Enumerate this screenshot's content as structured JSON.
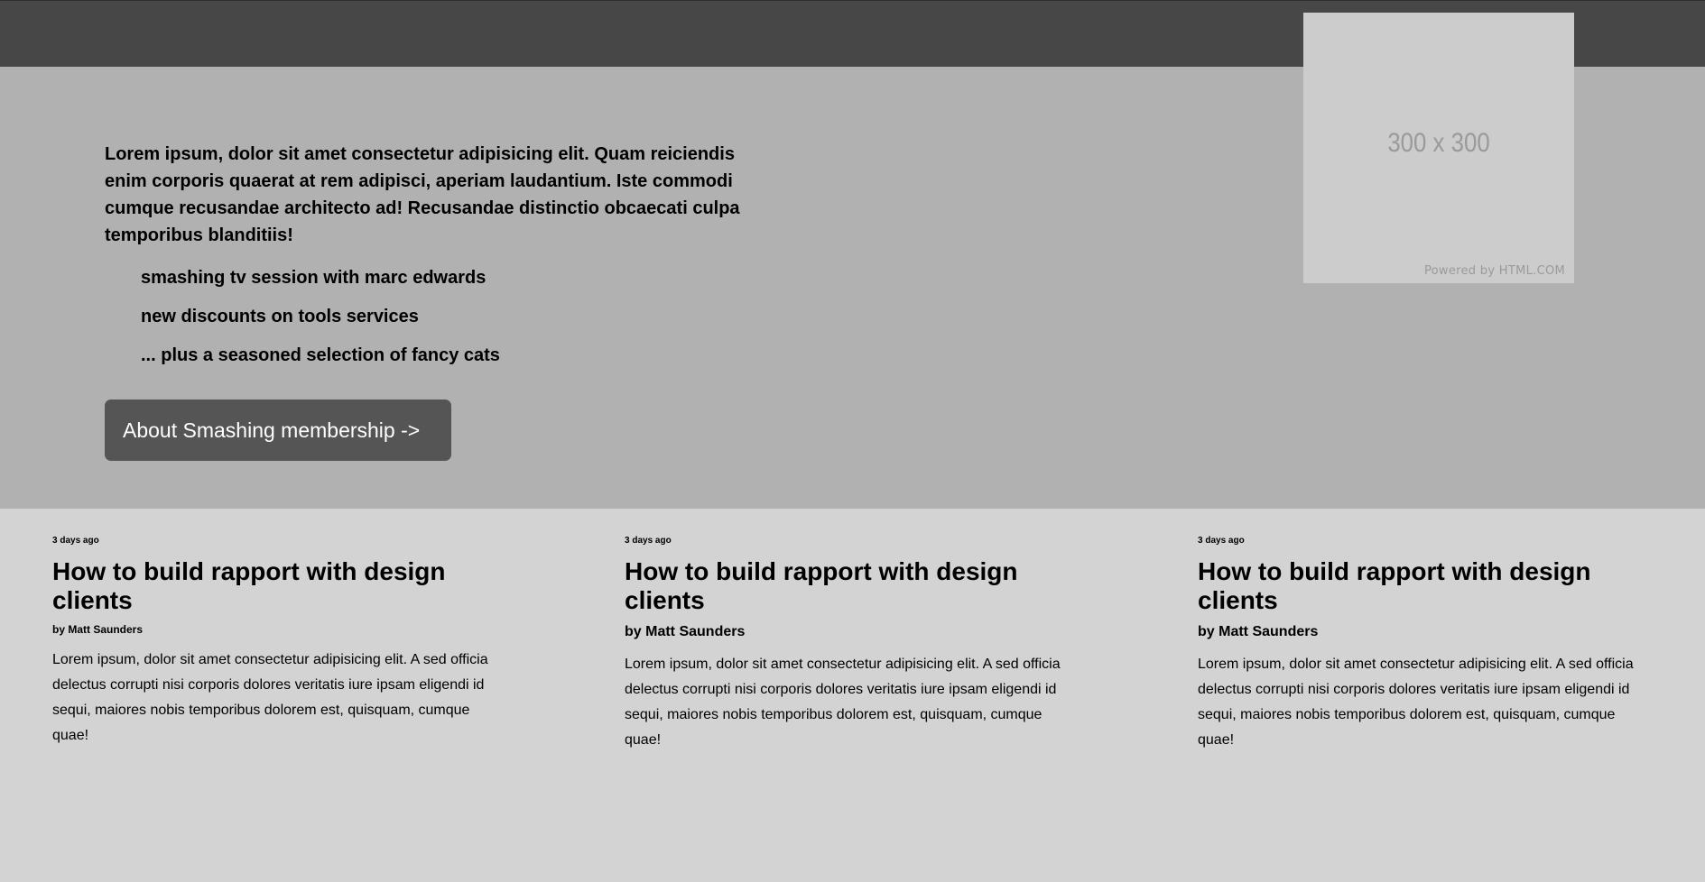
{
  "hero": {
    "intro": "Lorem ipsum, dolor sit amet consectetur adipisicing elit. Quam reiciendis enim corporis quaerat at rem adipisci, aperiam laudantium. Iste commodi cumque recusandae architecto ad! Recusandae distinctio obcaecati culpa temporibus blanditiis!",
    "list": [
      "smashing tv session with marc edwards",
      "new discounts on tools services",
      "... plus a seasoned selection of fancy cats"
    ],
    "cta_label": "About Smashing membership ->",
    "image": {
      "size_label": "300 x 300",
      "powered_label": "Powered by HTML.COM"
    }
  },
  "articles": [
    {
      "date": "3 days ago",
      "title": "How to build rapport with design clients",
      "author": "by Matt Saunders",
      "body": "Lorem ipsum, dolor sit amet consectetur adipisicing elit. A sed officia delectus corrupti nisi corporis dolores veritatis iure ipsam eligendi id sequi, maiores nobis temporibus dolorem est, quisquam, cumque quae!"
    },
    {
      "date": "3 days ago",
      "title": "How to build rapport with design clients",
      "author": "by Matt Saunders",
      "body": "Lorem ipsum, dolor sit amet consectetur adipisicing elit. A sed officia delectus corrupti nisi corporis dolores veritatis iure ipsam eligendi id sequi, maiores nobis temporibus dolorem est, quisquam, cumque quae!"
    },
    {
      "date": "3 days ago",
      "title": "How to build rapport with design clients",
      "author": "by Matt Saunders",
      "body": "Lorem ipsum, dolor sit amet consectetur adipisicing elit. A sed officia delectus corrupti nisi corporis dolores veritatis iure ipsam eligendi id sequi, maiores nobis temporibus dolorem est, quisquam, cumque quae!"
    }
  ],
  "colors": {
    "topbar": "#474747",
    "hero_bg": "#b1b1b1",
    "page_bg": "#d3d3d3",
    "button_bg": "#555555",
    "button_text": "#ffffff"
  }
}
